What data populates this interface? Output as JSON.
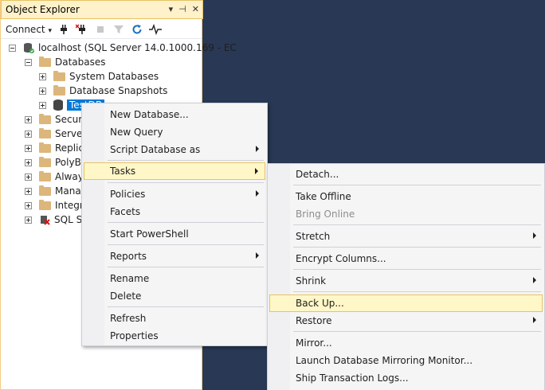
{
  "panel": {
    "title": "Object Explorer",
    "title_buttons": [
      "▾",
      "⊣",
      "✕"
    ]
  },
  "toolbar": {
    "connect_label": "Connect",
    "connect_arrow": "▾"
  },
  "tree": {
    "server": "localhost (SQL Server 14.0.1000.169 - EC",
    "databases": "Databases",
    "system_databases": "System Databases",
    "database_snapshots": "Database Snapshots",
    "selected_db": "TestDB",
    "security": "Securit",
    "server_objects": "Server",
    "replication": "Replica",
    "polybase": "PolyBa",
    "always_on": "Always",
    "management": "Manag",
    "integration": "Integra",
    "sql_agent": "SQL Se"
  },
  "context_menu": {
    "items": [
      {
        "label": "New Database..."
      },
      {
        "label": "New Query"
      },
      {
        "label": "Script Database as",
        "submenu": true
      },
      {
        "label": "Tasks",
        "submenu": true,
        "highlighted": true
      },
      {
        "label": "Policies",
        "submenu": true
      },
      {
        "label": "Facets"
      },
      {
        "label": "Start PowerShell"
      },
      {
        "label": "Reports",
        "submenu": true
      },
      {
        "label": "Rename"
      },
      {
        "label": "Delete"
      },
      {
        "label": "Refresh"
      },
      {
        "label": "Properties"
      }
    ]
  },
  "tasks_menu": {
    "items": [
      {
        "label": "Detach..."
      },
      {
        "label": "Take Offline"
      },
      {
        "label": "Bring Online",
        "disabled": true
      },
      {
        "label": "Stretch",
        "submenu": true
      },
      {
        "label": "Encrypt Columns..."
      },
      {
        "label": "Shrink",
        "submenu": true
      },
      {
        "label": "Back Up...",
        "highlighted": true
      },
      {
        "label": "Restore",
        "submenu": true
      },
      {
        "label": "Mirror..."
      },
      {
        "label": "Launch Database Mirroring Monitor..."
      },
      {
        "label": "Ship Transaction Logs..."
      }
    ]
  },
  "colors": {
    "background": "#293955",
    "highlight": "#fff7c7",
    "highlight_border": "#e5c365",
    "selection": "#0078d7"
  }
}
